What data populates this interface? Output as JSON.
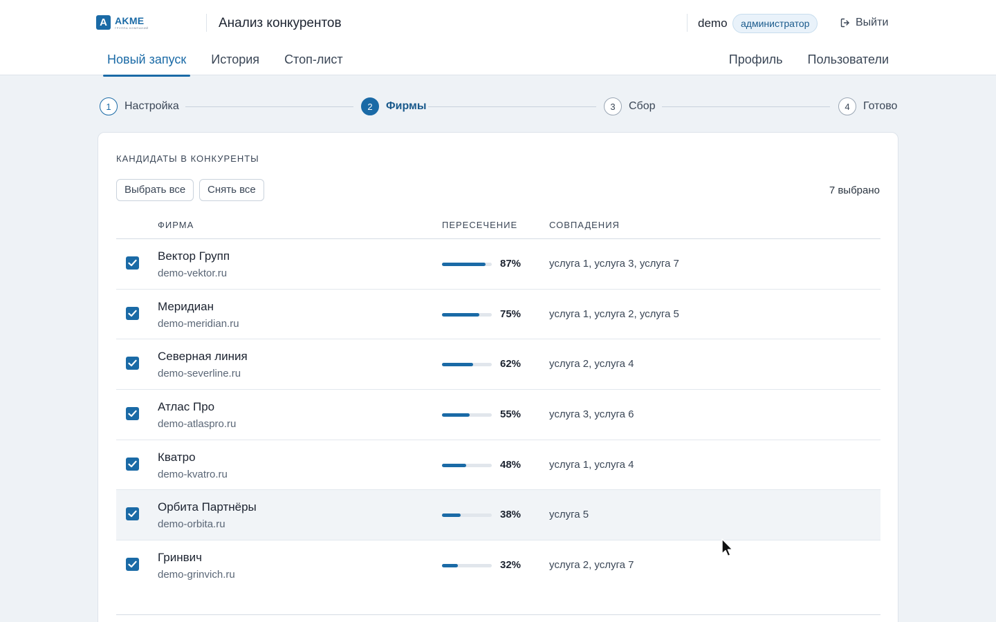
{
  "header": {
    "logo_letter": "A",
    "logo_name": "AKME",
    "logo_sub": "ГРУППА КОМПАНИЙ",
    "app_title": "Анализ конкурентов",
    "user_name": "demo",
    "role": "администратор",
    "logout_label": "Выйти"
  },
  "nav": {
    "left": [
      "Новый запуск",
      "История",
      "Стоп-лист"
    ],
    "right": [
      "Профиль",
      "Пользователи"
    ],
    "active": "Новый запуск"
  },
  "stepper": [
    {
      "num": "1",
      "label": "Настройка",
      "state": "done"
    },
    {
      "num": "2",
      "label": "Фирмы",
      "state": "current"
    },
    {
      "num": "3",
      "label": "Сбор",
      "state": "pending"
    },
    {
      "num": "4",
      "label": "Готово",
      "state": "pending"
    }
  ],
  "card": {
    "title": "КАНДИДАТЫ В КОНКУРЕНТЫ",
    "select_all": "Выбрать все",
    "deselect_all": "Снять все",
    "selected_count": "7 выбрано",
    "columns": {
      "firm": "ФИРМА",
      "overlap": "ПЕРЕСЕЧЕНИЕ",
      "matches": "СОВПАДЕНИЯ"
    },
    "rows": [
      {
        "name": "Вектор Групп",
        "domain": "demo-vektor.ru",
        "overlap": 87,
        "overlap_label": "87%",
        "matches": "услуга 1, услуга 3, услуга 7",
        "checked": true
      },
      {
        "name": "Меридиан",
        "domain": "demo-meridian.ru",
        "overlap": 75,
        "overlap_label": "75%",
        "matches": "услуга 1, услуга 2, услуга 5",
        "checked": true
      },
      {
        "name": "Северная линия",
        "domain": "demo-severline.ru",
        "overlap": 62,
        "overlap_label": "62%",
        "matches": "услуга 2, услуга 4",
        "checked": true
      },
      {
        "name": "Атлас Про",
        "domain": "demo-atlaspro.ru",
        "overlap": 55,
        "overlap_label": "55%",
        "matches": "услуга 3, услуга 6",
        "checked": true
      },
      {
        "name": "Кватро",
        "domain": "demo-kvatro.ru",
        "overlap": 48,
        "overlap_label": "48%",
        "matches": "услуга 1, услуга 4",
        "checked": true
      },
      {
        "name": "Орбита Партнёры",
        "domain": "demo-orbita.ru",
        "overlap": 38,
        "overlap_label": "38%",
        "matches": "услуга 5",
        "checked": true
      },
      {
        "name": "Гринвич",
        "domain": "demo-grinvich.ru",
        "overlap": 32,
        "overlap_label": "32%",
        "matches": "услуга 2, услуга 7",
        "checked": true
      }
    ]
  },
  "colors": {
    "accent": "#1a6aa6",
    "background": "#eef2f6",
    "track": "#e1e6ec"
  },
  "icons": {
    "logout": "logout-icon",
    "checkbox": "check-icon",
    "cursor": "mouse-pointer-icon"
  }
}
